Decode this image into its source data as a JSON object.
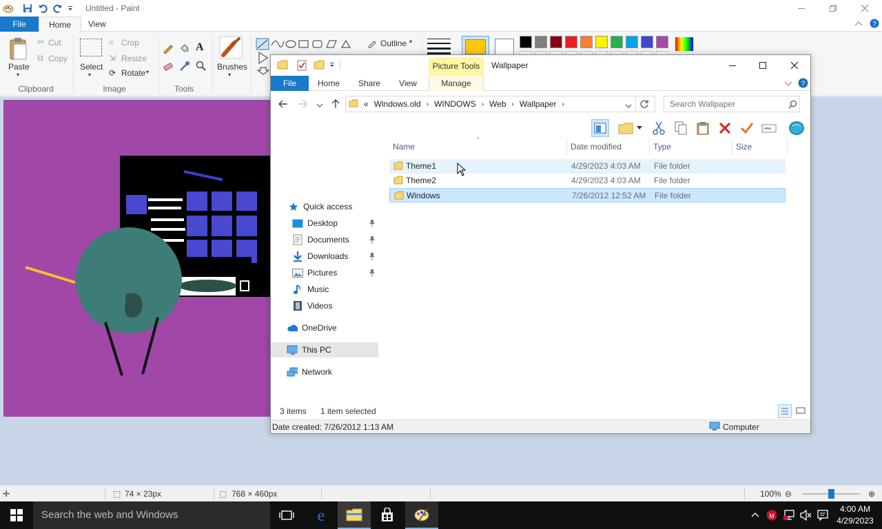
{
  "paint": {
    "title": "Untitled - Paint",
    "tabs": {
      "file": "File",
      "home": "Home",
      "view": "View"
    },
    "clipboard": {
      "paste": "Paste",
      "cut": "Cut",
      "copy": "Copy",
      "group": "Clipboard"
    },
    "image": {
      "select": "Select",
      "crop": "Crop",
      "resize": "Resize",
      "rotate": "Rotate",
      "group": "Image"
    },
    "tools": {
      "group": "Tools"
    },
    "brushes": "Brushes",
    "outline": "Outline",
    "status": {
      "selection_size": "74 × 23px",
      "canvas_size": "768 × 460px",
      "zoom": "100%"
    }
  },
  "explorer": {
    "title": "Wallpaper",
    "context_tab": "Picture Tools",
    "tabs": {
      "file": "File",
      "home": "Home",
      "share": "Share",
      "view": "View",
      "manage": "Manage"
    },
    "address": {
      "overflow": "«",
      "crumbs": [
        "Windows.old",
        "WINDOWS",
        "Web",
        "Wallpaper"
      ]
    },
    "search_placeholder": "Search Wallpaper",
    "nav": {
      "quick_access": "Quick access",
      "desktop": "Desktop",
      "documents": "Documents",
      "downloads": "Downloads",
      "pictures": "Pictures",
      "music": "Music",
      "videos": "Videos",
      "onedrive": "OneDrive",
      "this_pc": "This PC",
      "network": "Network"
    },
    "columns": {
      "name": "Name",
      "date": "Date modified",
      "type": "Type",
      "size": "Size"
    },
    "files": [
      {
        "name": "Theme1",
        "date": "4/29/2023 4:03 AM",
        "type": "File folder"
      },
      {
        "name": "Theme2",
        "date": "4/29/2023 4:03 AM",
        "type": "File folder"
      },
      {
        "name": "Windows",
        "date": "7/26/2012 12:52 AM",
        "type": "File folder"
      }
    ],
    "status": {
      "count": "3 items",
      "selected": "1 item selected"
    },
    "details": {
      "created": "Date created: 7/26/2012 1:13 AM",
      "location": "Computer"
    }
  },
  "taskbar": {
    "search": "Search the web and Windows",
    "time": "4:00 AM",
    "date": "4/29/2023"
  },
  "palette": [
    "#000000",
    "#7f7f7f",
    "#880015",
    "#ed1c24",
    "#ff7f27",
    "#fff200",
    "#22b14c",
    "#00a2e8",
    "#3f48cc",
    "#a349a4"
  ],
  "color1": "#ffc90e",
  "color2": "#ffffff"
}
